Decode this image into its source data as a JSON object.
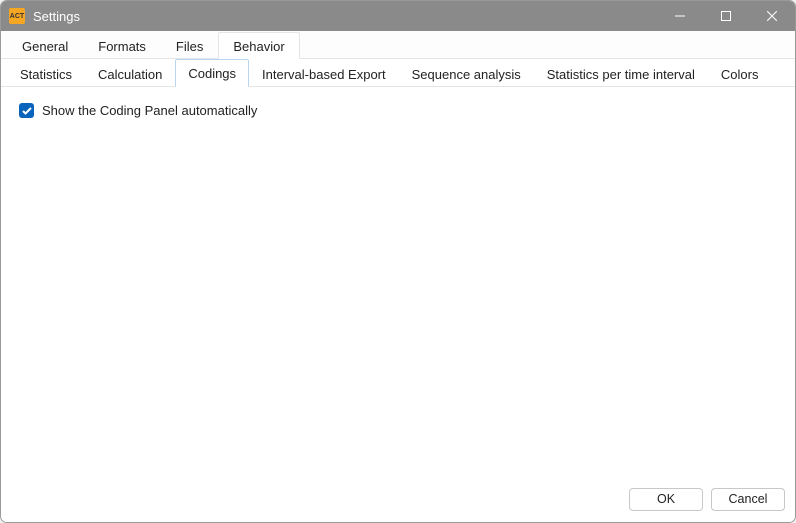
{
  "window": {
    "title": "Settings",
    "app_icon_text": "ACT"
  },
  "tabs": {
    "items": [
      {
        "label": "General"
      },
      {
        "label": "Formats"
      },
      {
        "label": "Files"
      },
      {
        "label": "Behavior"
      }
    ],
    "active_index": 3
  },
  "subtabs": {
    "items": [
      {
        "label": "Statistics"
      },
      {
        "label": "Calculation"
      },
      {
        "label": "Codings"
      },
      {
        "label": "Interval-based Export"
      },
      {
        "label": "Sequence analysis"
      },
      {
        "label": "Statistics per time interval"
      },
      {
        "label": "Colors"
      }
    ],
    "active_index": 2
  },
  "content": {
    "checkbox": {
      "checked": true,
      "label": "Show the Coding Panel automatically"
    }
  },
  "footer": {
    "ok_label": "OK",
    "cancel_label": "Cancel"
  }
}
